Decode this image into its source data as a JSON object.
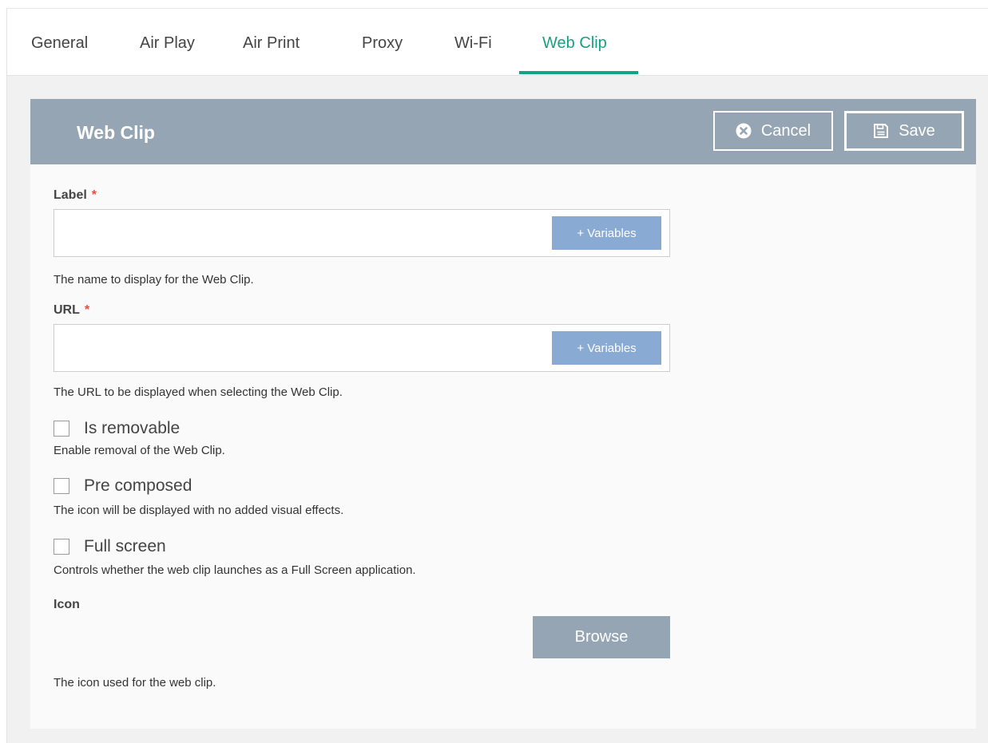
{
  "tabs": [
    {
      "label": "General"
    },
    {
      "label": "Air Play"
    },
    {
      "label": "Air Print"
    },
    {
      "label": "Proxy"
    },
    {
      "label": "Wi-Fi"
    },
    {
      "label": "Web Clip",
      "active": true
    }
  ],
  "panel": {
    "title": "Web Clip",
    "cancel_label": "Cancel",
    "save_label": "Save"
  },
  "form": {
    "label_field": {
      "label": "Label",
      "required_mark": "*",
      "value": "",
      "variables_label": "+ Variables",
      "help": "The name to display for the Web Clip."
    },
    "url_field": {
      "label": "URL",
      "required_mark": "*",
      "value": "",
      "variables_label": "+ Variables",
      "help": "The URL to be displayed when selecting the Web Clip."
    },
    "is_removable": {
      "label": "Is removable",
      "checked": false,
      "help": "Enable removal of the Web Clip."
    },
    "pre_composed": {
      "label": "Pre composed",
      "checked": false,
      "help": "The icon will be displayed with no added visual effects."
    },
    "full_screen": {
      "label": "Full screen",
      "checked": false,
      "help": "Controls whether the web clip launches as a Full Screen application."
    },
    "icon": {
      "label": "Icon",
      "browse_label": "Browse",
      "help": "The icon used for the web clip."
    }
  },
  "colors": {
    "accent": "#16a085",
    "header_bg": "#95a5b3",
    "variables_button": "#88aad3",
    "required": "#e74c3c"
  },
  "icons": {
    "cancel": "x-circle-icon",
    "save": "floppy-disk-icon"
  }
}
